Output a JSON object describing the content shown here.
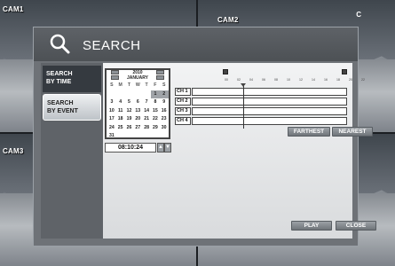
{
  "cameras": [
    {
      "label": "CAM1"
    },
    {
      "label": "CAM2"
    },
    {
      "label": "CAM3"
    },
    {
      "label": ""
    }
  ],
  "header": {
    "title": "SEARCH",
    "icon": "magnifier-icon",
    "extra_label": "C"
  },
  "sidebar": {
    "items": [
      {
        "label": "SEARCH BY TIME",
        "line1": "SEARCH",
        "line2": "BY TIME"
      },
      {
        "label": "SEARCH BY EVENT",
        "line1": "SEARCH",
        "line2": "BY EVENT"
      }
    ]
  },
  "calendar": {
    "year": "2010",
    "month": "JANUARY",
    "weekdays": [
      "S",
      "M",
      "T",
      "W",
      "T",
      "F",
      "S"
    ],
    "weeks": [
      [
        "",
        "",
        "",
        "",
        "",
        "1",
        "2"
      ],
      [
        "3",
        "4",
        "5",
        "6",
        "7",
        "8",
        "9"
      ],
      [
        "10",
        "11",
        "12",
        "13",
        "14",
        "15",
        "16"
      ],
      [
        "17",
        "18",
        "19",
        "20",
        "21",
        "22",
        "23"
      ],
      [
        "24",
        "25",
        "26",
        "27",
        "28",
        "29",
        "30"
      ],
      [
        "31",
        "",
        "",
        "",
        "",
        "",
        ""
      ]
    ],
    "highlighted": [
      "1",
      "2"
    ]
  },
  "time": {
    "value": "08:10:24"
  },
  "timeline": {
    "hours": [
      "00",
      "02",
      "04",
      "06",
      "08",
      "10",
      "12",
      "14",
      "16",
      "18",
      "20",
      "22"
    ],
    "channels": [
      "CH 1",
      "CH 2",
      "CH 3",
      "CH 4"
    ]
  },
  "buttons": {
    "farthest": "FARTHEST",
    "nearest": "NEAREST",
    "play": "PLAY",
    "close": "CLOSE"
  }
}
